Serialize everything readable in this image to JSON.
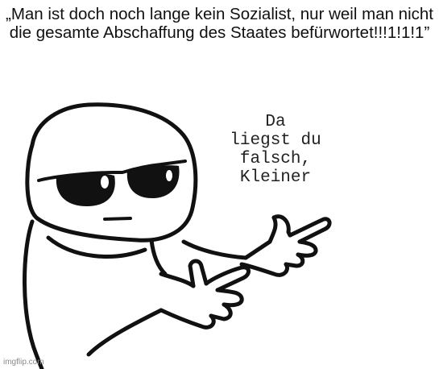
{
  "caption": {
    "text": "„Man ist doch noch lange kein Sozialist, nur weil man nicht die gesamte Abschaffung des Staates befürwortet!!!1!1!1”"
  },
  "speech": {
    "text": "Da\nliegst du\nfalsch,\nKleiner"
  },
  "watermark": {
    "text": "imgflip.com"
  },
  "colors": {
    "background": "#ffffff",
    "ink": "#111111"
  },
  "icons": [
    "cartoon-guy-with-sunglasses-pointing"
  ]
}
